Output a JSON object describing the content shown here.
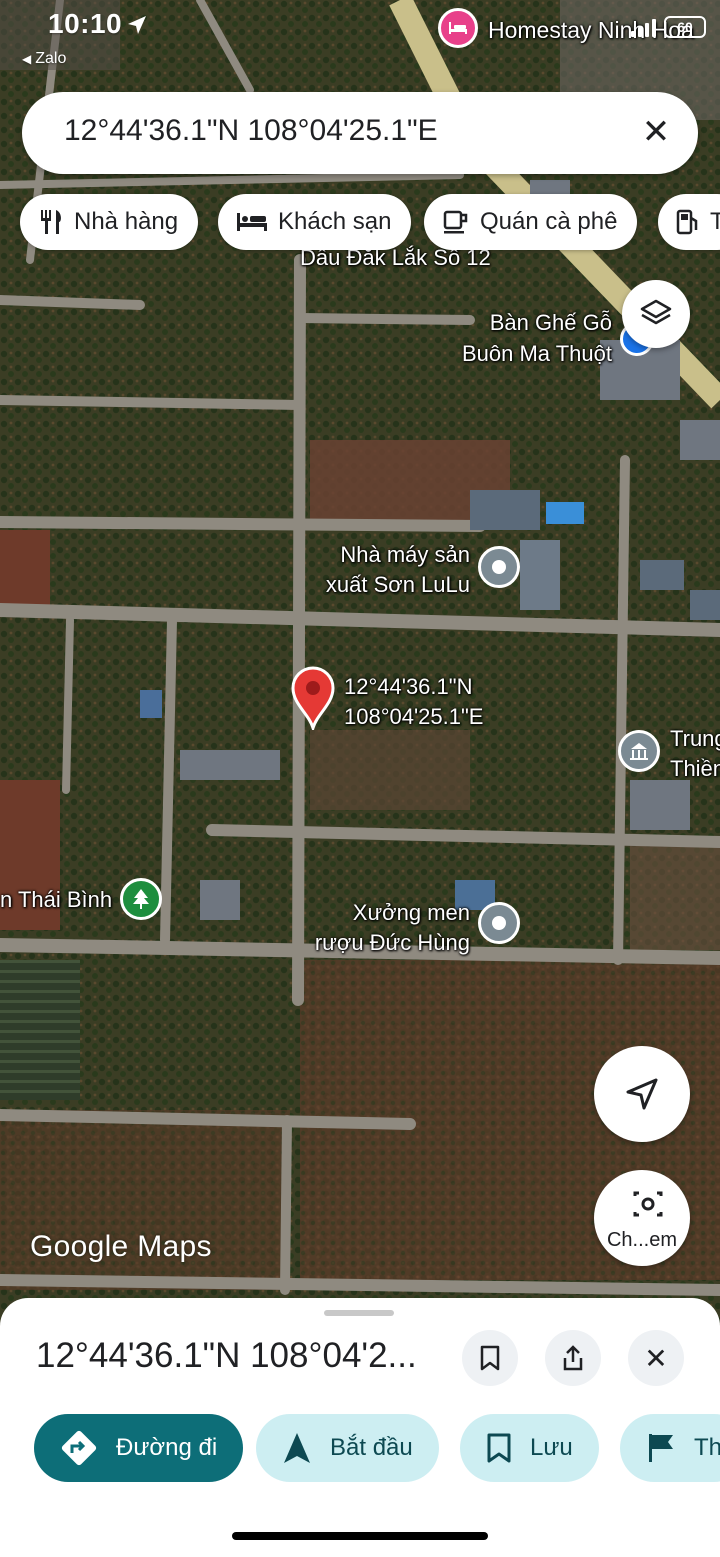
{
  "status_bar": {
    "time": "10:10",
    "back_app": "Zalo",
    "battery": "60"
  },
  "search": {
    "value": "12°44'36.1\"N 108°04'25.1\"E"
  },
  "chips": [
    {
      "label": "Nhà hàng",
      "icon": "fork-knife-icon"
    },
    {
      "label": "Khách sạn",
      "icon": "bed-icon"
    },
    {
      "label": "Quán cà phê",
      "icon": "coffee-cup-icon"
    },
    {
      "label": "T",
      "icon": "gas-station-icon"
    }
  ],
  "places": {
    "homestay": "Homestay Ninh Hoa",
    "dau": "Dầu Đắk Lắk Số 12",
    "ban_ghe_1": "Bàn Ghế Gỗ",
    "ban_ghe_2": "Buôn Ma Thuột",
    "nha_may_1": "Nhà máy sản",
    "nha_may_2": "xuất Sơn LuLu",
    "pin_1": "12°44'36.1\"N",
    "pin_2": "108°04'25.1\"E",
    "trung_1": "Trung",
    "trung_2": "Thiền",
    "thai_binh": "n Thái Bình",
    "xuong_1": "Xưởng men",
    "xuong_2": "rượu Đức Hùng"
  },
  "map_controls": {
    "camera_label": "Ch...em"
  },
  "branding": {
    "google": "Google",
    "maps": "Maps"
  },
  "sheet": {
    "title": "12°44'36.1\"N 108°04'2...",
    "actions": [
      {
        "label": "Đường đi",
        "icon": "directions-icon"
      },
      {
        "label": "Bắt đầu",
        "icon": "navigation-arrow-icon"
      },
      {
        "label": "Lưu",
        "icon": "bookmark-icon"
      },
      {
        "label": "Th",
        "icon": "flag-icon"
      }
    ]
  },
  "colors": {
    "primary": "#0d6e78",
    "secondary": "#cdeef2",
    "pin": "#e53935",
    "poi_gray": "#7b8a93",
    "poi_green": "#1e8e3e",
    "poi_pink": "#e8408a"
  }
}
